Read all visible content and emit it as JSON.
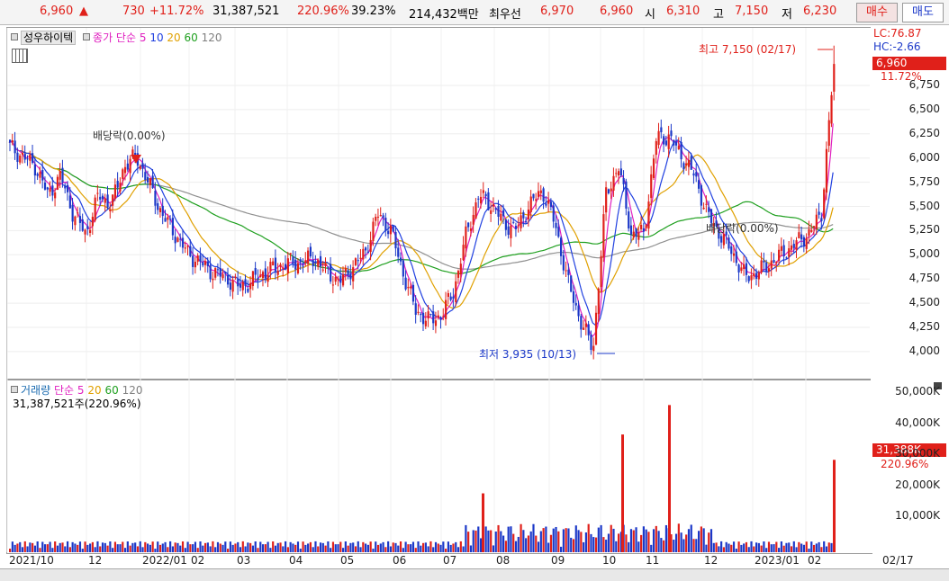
{
  "topbar": {
    "price": "6,960",
    "arrow": "▲",
    "change": "730",
    "change_pct": "+11.72%",
    "volume": "31,387,521",
    "volume_ratio": "220.96%",
    "turnover": "39.23%",
    "amount": "214,432백만",
    "best_ask_label": "최우선",
    "best_ask": "6,970",
    "best_bid": "6,960",
    "open_label": "시",
    "open": "6,310",
    "high_label": "고",
    "high": "7,150",
    "low_label": "저",
    "low": "6,230",
    "buy_button": "매수",
    "sell_button": "매도"
  },
  "price_pane": {
    "stock_name": "성우하이텍",
    "ma_label": "종가 단순",
    "ma": [
      "5",
      "10",
      "20",
      "60",
      "120"
    ],
    "ma_colors": [
      "#e020c0",
      "#2040e0",
      "#e0a000",
      "#20a020",
      "#808080"
    ],
    "lc": "LC:76.87",
    "hc": "HC:-2.66",
    "high_annot": "최고 7,150 (02/17)",
    "low_annot": "최저 3,935 (10/13)",
    "div1": "배당락(0.00%)",
    "div2": "배당락(0.00%)",
    "current_price": "6,960",
    "current_pct": "11.72%",
    "y_ticks": [
      "6,750",
      "6,500",
      "6,250",
      "6,000",
      "5,750",
      "5,500",
      "5,250",
      "5,000",
      "4,750",
      "4,500",
      "4,250",
      "4,000"
    ]
  },
  "volume_pane": {
    "label": "거래량",
    "ma_label": "단순",
    "ma": [
      "5",
      "20",
      "60",
      "120"
    ],
    "summary": "31,387,521주(220.96%)",
    "current": "31,388K",
    "current_pct": "220.96%",
    "y_ticks": [
      "50,000K",
      "40,000K",
      "30,000K",
      "20,000K",
      "10,000K"
    ]
  },
  "x_axis": [
    "2021/10",
    "12",
    "2022/01",
    "02",
    "03",
    "04",
    "05",
    "06",
    "07",
    "08",
    "09",
    "10",
    "11",
    "12",
    "2023/01",
    "02",
    "02/17"
  ],
  "colors": {
    "up": "#e0201a",
    "down": "#1b38c8"
  },
  "chart_data": {
    "type": "candlestick",
    "price_range": [
      3800,
      7250
    ],
    "close_series_approx": [
      6100,
      6000,
      5900,
      5600,
      5800,
      5400,
      5200,
      5600,
      5500,
      5900,
      6000,
      5700,
      5400,
      5200,
      5000,
      4900,
      4800,
      4750,
      4650,
      4700,
      4800,
      4850,
      4900,
      4900,
      4950,
      4800,
      4700,
      4850,
      5000,
      5400,
      5250,
      4800,
      4400,
      4300,
      4350,
      4600,
      5200,
      5600,
      5500,
      5300,
      5250,
      5500,
      5650,
      5300,
      4700,
      4300,
      4000,
      5600,
      5900,
      5200,
      5200,
      6200,
      6200,
      6000,
      5800,
      5400,
      5200,
      5000,
      4750,
      4800,
      4900,
      5000,
      5100,
      5200,
      5400,
      6960
    ],
    "volume_range_k": [
      0,
      55000
    ],
    "volume_peaks_k": [
      {
        "date": "07",
        "v": 20000
      },
      {
        "date": "10",
        "v": 40000
      },
      {
        "date": "11",
        "v": 50000
      },
      {
        "date": "02/17",
        "v": 31388
      }
    ]
  }
}
